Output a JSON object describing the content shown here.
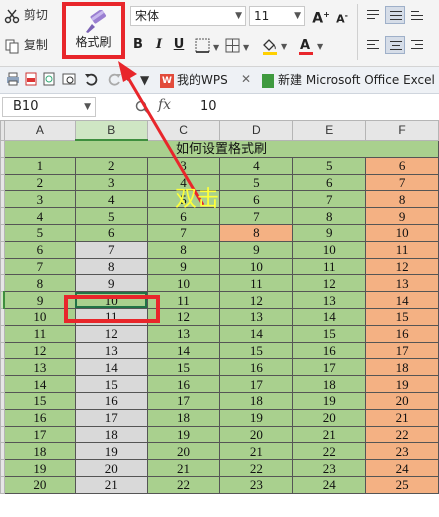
{
  "ribbon": {
    "cut_label": "剪切",
    "copy_label": "复制",
    "format_painter_label": "格式刷",
    "font_name": "宋体",
    "font_size": "11",
    "bold": "B",
    "italic": "I",
    "underline": "U",
    "grow_font": "A",
    "shrink_font": "A"
  },
  "tabs": [
    {
      "label": "我的WPS",
      "logo": "W"
    },
    {
      "label": "新建 Microsoft Office Excel"
    }
  ],
  "formula_bar": {
    "name_box": "B10",
    "fx": "fx",
    "value": "10"
  },
  "sheet": {
    "columns": [
      "A",
      "B",
      "C",
      "D",
      "E",
      "F"
    ],
    "title": "如何设置格式刷",
    "row_headers": [
      "",
      "1",
      "2",
      "3",
      "4",
      "5",
      "6",
      "7",
      "8",
      "9",
      "10",
      "11",
      "12",
      "13",
      "14",
      "15",
      "16",
      "17",
      "18",
      "19",
      "20"
    ]
  },
  "annotation": {
    "double_click_text": "双击"
  },
  "colors": {
    "green": "#a9d08e",
    "gray": "#d9d9d9",
    "orange": "#f4b183",
    "highlight_red": "#e8262b",
    "annotation_yellow": "#ffff3a"
  }
}
